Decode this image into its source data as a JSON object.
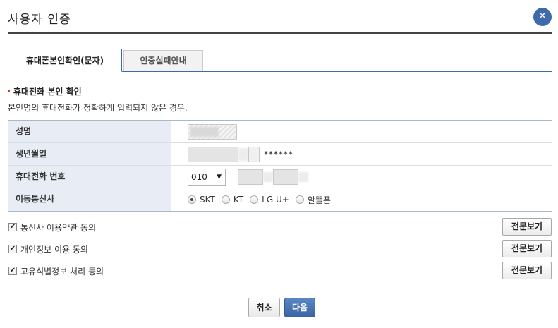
{
  "dialog": {
    "title": "사용자 인증",
    "close_symbol": "✕"
  },
  "tabs": [
    {
      "label": "휴대폰본인확인(문자)",
      "active": true
    },
    {
      "label": "인증실패안내",
      "active": false
    }
  ],
  "section": {
    "title": "휴대전화 본인 확인",
    "description": "본인명의 휴대전화가 정확하게 입력되지 않은 경우."
  },
  "form": {
    "name_label": "성명",
    "birth_label": "생년월일",
    "birth_masked": "******",
    "phone_label": "휴대전화 번호",
    "phone_prefix": "010",
    "phone_prefix_arrow": "▼",
    "phone_separator": "-",
    "carrier_label": "이동통신사",
    "carriers": [
      {
        "label": "SKT",
        "checked": true
      },
      {
        "label": "KT",
        "checked": false
      },
      {
        "label": "LG U+",
        "checked": false
      },
      {
        "label": "알뜰폰",
        "checked": false
      }
    ]
  },
  "agreements": [
    {
      "label": "통신사 이용약관 동의",
      "checked": true,
      "button": "전문보기"
    },
    {
      "label": "개인정보 이용 동의",
      "checked": true,
      "button": "전문보기"
    },
    {
      "label": "고유식별정보 처리 동의",
      "checked": true,
      "button": "전문보기"
    }
  ],
  "checkmark": "✔",
  "actions": {
    "cancel": "취소",
    "next": "다음"
  },
  "colors": {
    "accent": "#3d6aa8",
    "label_bg": "#e8edf5"
  },
  "icons": {
    "close": "close-icon",
    "dropdown": "chevron-down-icon",
    "check": "check-icon"
  }
}
